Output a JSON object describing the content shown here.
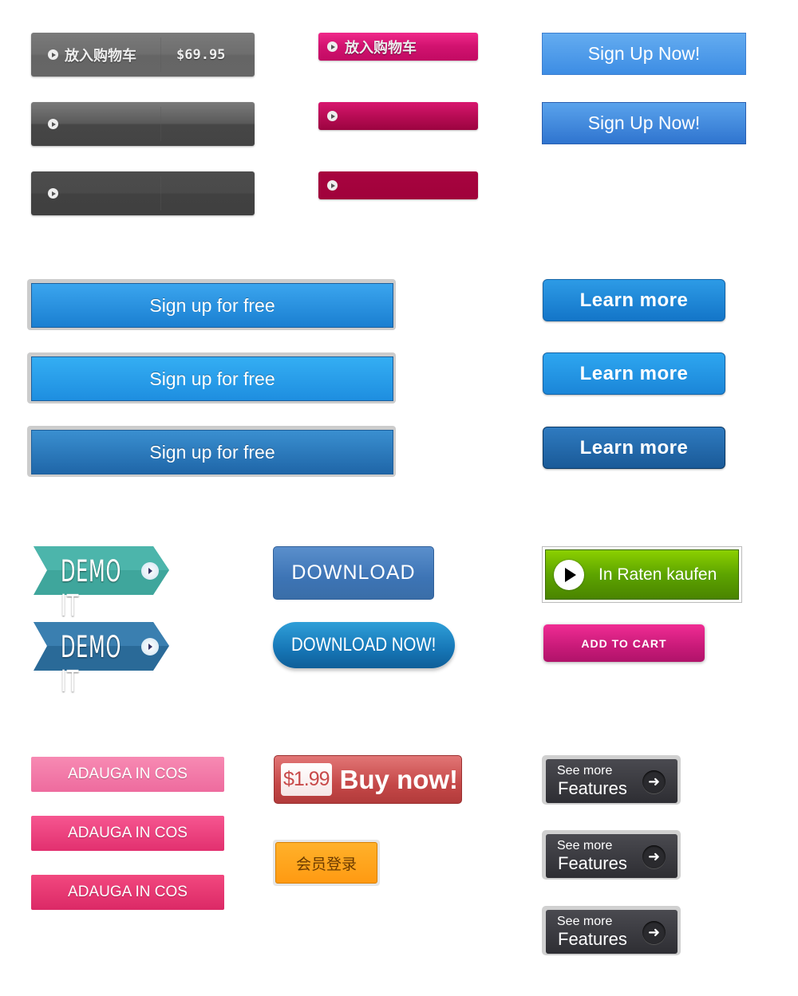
{
  "cart_gray": {
    "label": "放入购物车",
    "price": "$69.95"
  },
  "cart_pink": {
    "label": "放入购物车"
  },
  "signup_now": [
    "Sign Up Now!",
    "Sign Up Now!"
  ],
  "signup_free": [
    "Sign up for free",
    "Sign up for free",
    "Sign up for free"
  ],
  "learn_more": [
    "Learn more",
    "Learn more",
    "Learn more"
  ],
  "demo_it": [
    "DEMO IT",
    "DEMO IT"
  ],
  "download": "DOWNLOAD",
  "download_now": "DOWNLOAD NOW!",
  "raten": "In Raten kaufen",
  "add_to_cart": "ADD TO CART",
  "adauga": [
    "ADAUGA IN COS",
    "ADAUGA IN COS",
    "ADAUGA IN COS"
  ],
  "buy": {
    "price": "$1.99",
    "label": "Buy now!"
  },
  "member_login": "会员登录",
  "see_more": [
    {
      "line1": "See more",
      "line2": "Features"
    },
    {
      "line1": "See more",
      "line2": "Features"
    },
    {
      "line1": "See more",
      "line2": "Features"
    }
  ],
  "colors": {
    "teal": "#3fa9a0",
    "blue": "#2e7bbf",
    "green": "#6ab800",
    "pink": "#e0237f",
    "orange": "#ffa31c"
  }
}
